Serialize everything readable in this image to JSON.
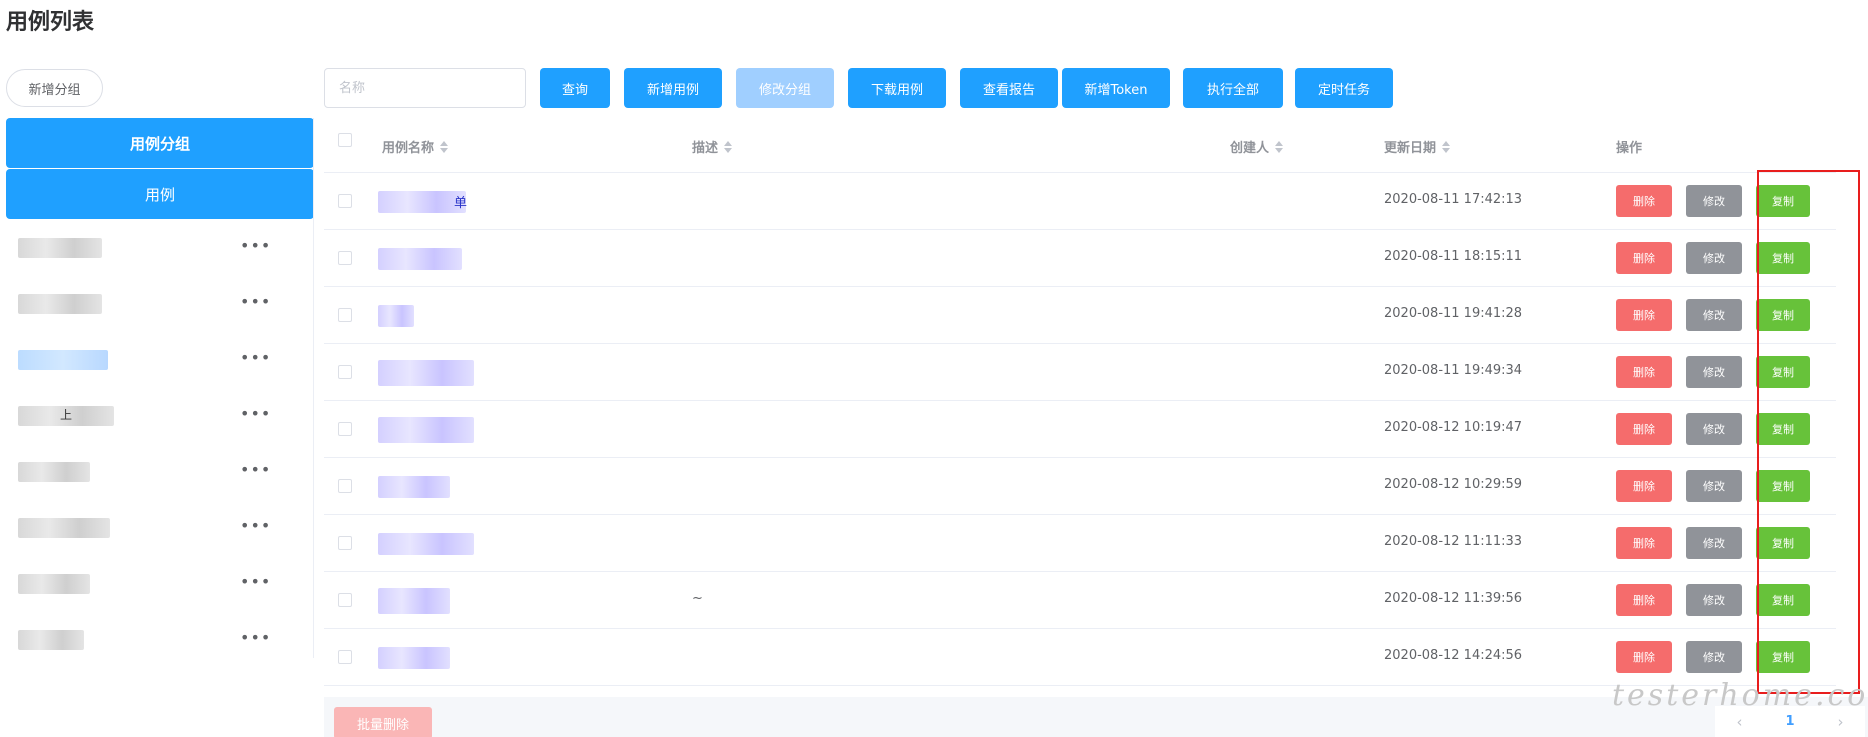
{
  "page": {
    "title": "用例列表"
  },
  "sidebar": {
    "add_group_label": "新增分组",
    "active_group_label": "用例分组",
    "all_cases_label": "用例",
    "items": [
      {
        "label": "",
        "menu_icon": "more-horizontal-icon"
      },
      {
        "label": "",
        "menu_icon": "more-horizontal-icon"
      },
      {
        "label": "",
        "menu_icon": "more-horizontal-icon",
        "highlighted": true
      },
      {
        "label": "上",
        "menu_icon": "more-horizontal-icon"
      },
      {
        "label": "",
        "menu_icon": "more-horizontal-icon"
      },
      {
        "label": "",
        "menu_icon": "more-horizontal-icon"
      },
      {
        "label": "",
        "menu_icon": "more-horizontal-icon"
      },
      {
        "label": "",
        "menu_icon": "more-horizontal-icon"
      }
    ]
  },
  "toolbar": {
    "search_placeholder": "名称",
    "query_label": "查询",
    "add_case_label": "新增用例",
    "edit_group_label": "修改分组",
    "download_label": "下载用例",
    "report_label": "查看报告",
    "add_token_label": "新增Token",
    "run_all_label": "执行全部",
    "schedule_label": "定时任务"
  },
  "table": {
    "headers": {
      "name": "用例名称",
      "desc": "描述",
      "creator": "创建人",
      "updated": "更新日期",
      "actions": "操作"
    },
    "action_labels": {
      "delete": "删除",
      "edit": "修改",
      "copy": "复制"
    },
    "rows": [
      {
        "name": "单",
        "desc": "",
        "updated": "2020-08-11 17:42:13"
      },
      {
        "name": "",
        "desc": "",
        "updated": "2020-08-11 18:15:11"
      },
      {
        "name": "",
        "desc": "",
        "updated": "2020-08-11 19:41:28"
      },
      {
        "name": "",
        "desc": "",
        "updated": "2020-08-11 19:49:34"
      },
      {
        "name": "",
        "desc": "",
        "updated": "2020-08-12 10:19:47"
      },
      {
        "name": "",
        "desc": "",
        "updated": "2020-08-12 10:29:59"
      },
      {
        "name": "",
        "desc": "",
        "updated": "2020-08-12 11:11:33"
      },
      {
        "name": "",
        "desc": "~",
        "updated": "2020-08-12 11:39:56"
      },
      {
        "name": "",
        "desc": "",
        "updated": "2020-08-12 14:24:56"
      }
    ]
  },
  "footer": {
    "batch_delete_label": "批量删除",
    "current_page": "1"
  },
  "watermark": "testerhome.com",
  "colors": {
    "primary": "#1fa0ff",
    "danger": "#f56c6c",
    "info": "#909399",
    "success": "#67c23a",
    "highlight": "#e81d1d"
  }
}
